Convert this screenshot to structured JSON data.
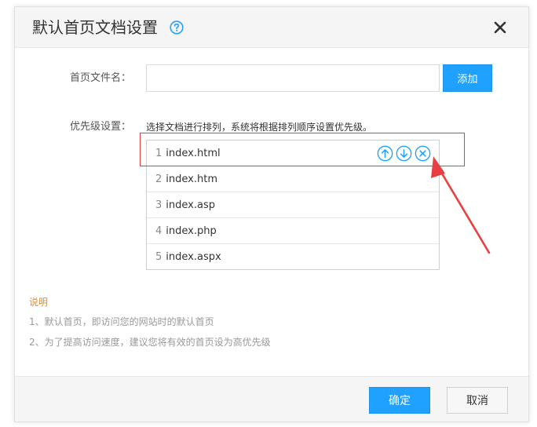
{
  "dialog": {
    "title": "默认首页文档设置",
    "help_icon": "question-circle-icon",
    "close_icon": "close-x-icon"
  },
  "form": {
    "name_label": "首页文件名：",
    "name_value": "",
    "name_placeholder": "",
    "add_label": "添加",
    "priority_label": "优先级设置：",
    "priority_hint": "选择文档进行排列，系统将根据排列顺序设置优先级。"
  },
  "files": [
    {
      "num": "1",
      "name": "index.html"
    },
    {
      "num": "2",
      "name": "index.htm"
    },
    {
      "num": "3",
      "name": "index.asp"
    },
    {
      "num": "4",
      "name": "index.php"
    },
    {
      "num": "5",
      "name": "index.aspx"
    }
  ],
  "row_action_icons": [
    "arrow-up-circle-icon",
    "arrow-down-circle-icon",
    "close-circle-icon"
  ],
  "notes": {
    "title": "说明",
    "line1": "1、默认首页，即访问您的网站时的默认首页",
    "line2": "2、为了提高访问速度，建议您将有效的首页设为高优先级"
  },
  "footer": {
    "ok_label": "确定",
    "cancel_label": "取消"
  },
  "colors": {
    "primary": "#20a0ff",
    "annotation_red": "#e04040",
    "note_title": "#f08a24"
  }
}
